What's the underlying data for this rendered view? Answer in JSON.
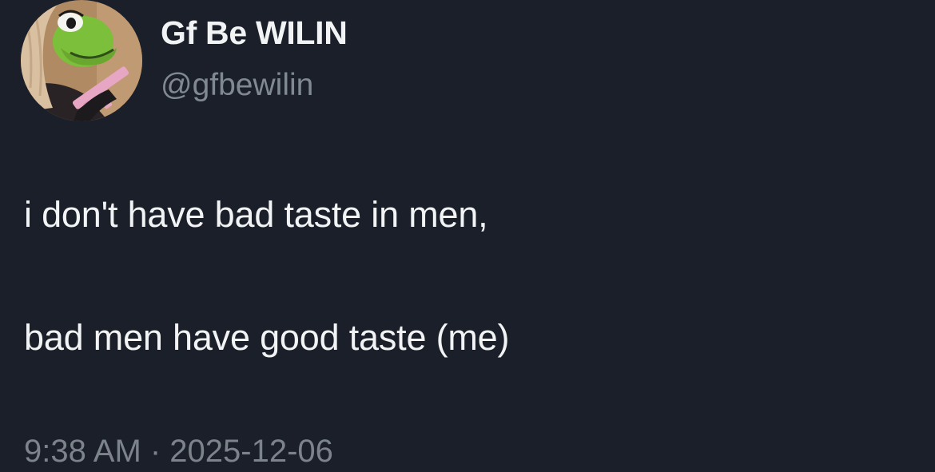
{
  "author": {
    "display_name": "Gf Be WILIN",
    "handle": "@gfbewilin",
    "avatar_icon": "kermit-frog-avatar-icon"
  },
  "tweet": {
    "lines": [
      "i don't have bad taste in men,",
      "bad men have good taste (me)"
    ],
    "timestamp": "9:38 AM · 2025-12-06"
  },
  "colors": {
    "background": "#1a1f29",
    "text": "#f1f3f4",
    "secondary_text": "#808891"
  }
}
